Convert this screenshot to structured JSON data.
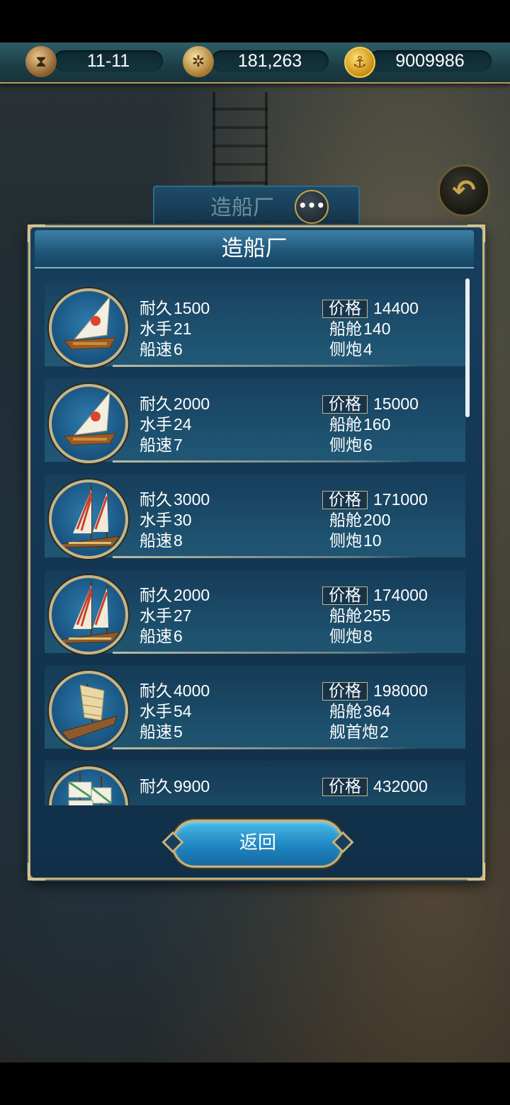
{
  "top_bar": {
    "date": "11-11",
    "compass_value": "181,263",
    "gold": "9009986"
  },
  "background": {
    "title": "造船厂"
  },
  "dialog": {
    "title": "造船厂",
    "return_label": "返回"
  },
  "ships": [
    {
      "durability_label": "耐久",
      "durability": "1500",
      "sailors_label": "水手",
      "sailors": "21",
      "speed_label": "船速",
      "speed": "6",
      "price_label": "价格",
      "price": "14400",
      "cabin_label": "船舱",
      "cabin": "140",
      "cannon_label": "侧炮",
      "cannon": "4"
    },
    {
      "durability_label": "耐久",
      "durability": "2000",
      "sailors_label": "水手",
      "sailors": "24",
      "speed_label": "船速",
      "speed": "7",
      "price_label": "价格",
      "price": "15000",
      "cabin_label": "船舱",
      "cabin": "160",
      "cannon_label": "侧炮",
      "cannon": "6"
    },
    {
      "durability_label": "耐久",
      "durability": "3000",
      "sailors_label": "水手",
      "sailors": "30",
      "speed_label": "船速",
      "speed": "8",
      "price_label": "价格",
      "price": "171000",
      "cabin_label": "船舱",
      "cabin": "200",
      "cannon_label": "侧炮",
      "cannon": "10"
    },
    {
      "durability_label": "耐久",
      "durability": "2000",
      "sailors_label": "水手",
      "sailors": "27",
      "speed_label": "船速",
      "speed": "6",
      "price_label": "价格",
      "price": "174000",
      "cabin_label": "船舱",
      "cabin": "255",
      "cannon_label": "侧炮",
      "cannon": "8"
    },
    {
      "durability_label": "耐久",
      "durability": "4000",
      "sailors_label": "水手",
      "sailors": "54",
      "speed_label": "船速",
      "speed": "5",
      "price_label": "价格",
      "price": "198000",
      "cabin_label": "船舱",
      "cabin": "364",
      "cannon_label": "舰首炮",
      "cannon": "2"
    },
    {
      "durability_label": "耐久",
      "durability": "9900",
      "price_label": "价格",
      "price": "432000"
    }
  ],
  "icons": {
    "date": "hourglass-icon",
    "compass": "compass-icon",
    "gold": "anchor-coin-icon",
    "back": "back-arrow-icon",
    "chat": "chat-icon"
  },
  "colors": {
    "accent_gold": "#c9b27a",
    "panel_blue": "#173f5c",
    "button_blue": "#1f86c2"
  }
}
